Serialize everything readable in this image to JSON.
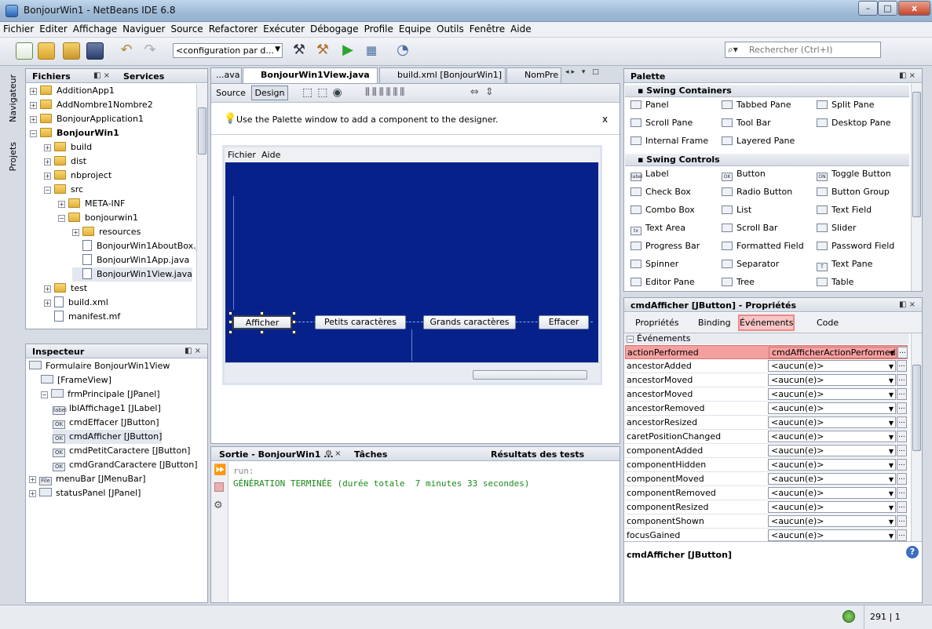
{
  "window": {
    "title": "BonjourWin1 - NetBeans IDE 6.8",
    "min": "–",
    "max": "□",
    "close": "x"
  },
  "menu": [
    "Fichier",
    "Editer",
    "Affichage",
    "Naviguer",
    "Source",
    "Refactorer",
    "Exécuter",
    "Débogage",
    "Profile",
    "Equipe",
    "Outils",
    "Fenêtre",
    "Aide"
  ],
  "toolbar": {
    "config": "<configuration par d...",
    "search_placeholder": "Rechercher (Ctrl+I)"
  },
  "left_strip": {
    "navigator": "Navigateur",
    "projects": "Projets"
  },
  "files_panel": {
    "tab1": "Fichiers",
    "tab2": "Services",
    "items": [
      {
        "label": "AdditionApp1"
      },
      {
        "label": "AddNombre1Nombre2"
      },
      {
        "label": "BonjourApplication1"
      },
      {
        "label": "BonjourWin1"
      },
      {
        "label": "build"
      },
      {
        "label": "dist"
      },
      {
        "label": "nbproject"
      },
      {
        "label": "src"
      },
      {
        "label": "META-INF"
      },
      {
        "label": "bonjourwin1"
      },
      {
        "label": "resources"
      },
      {
        "label": "BonjourWin1AboutBox.j"
      },
      {
        "label": "BonjourWin1App.java"
      },
      {
        "label": "BonjourWin1View.java"
      },
      {
        "label": "test"
      },
      {
        "label": "build.xml"
      },
      {
        "label": "manifest.mf"
      }
    ]
  },
  "inspector": {
    "title": "Inspecteur",
    "items": [
      {
        "label": "Formulaire BonjourWin1View"
      },
      {
        "label": "[FrameView]"
      },
      {
        "label": "frmPrincipale [JPanel]"
      },
      {
        "label": "lblAffichage1 [JLabel]",
        "icon": "label"
      },
      {
        "label": "cmdEffacer [JButton]",
        "icon": "OK"
      },
      {
        "label": "cmdAfficher [JButton]",
        "icon": "OK"
      },
      {
        "label": "cmdPetitCaractere [JButton]",
        "icon": "OK"
      },
      {
        "label": "cmdGrandCaractere [JButton]",
        "icon": "OK"
      },
      {
        "label": "menuBar [JMenuBar]",
        "icon": "File"
      },
      {
        "label": "statusPanel [JPanel]"
      }
    ]
  },
  "editor": {
    "tabs": [
      "...ava",
      "BonjourWin1View.java",
      "build.xml [BonjourWin1]",
      "NomPre"
    ],
    "source_label": "Source",
    "design_label": "Design",
    "hint": "Use the Palette window to add a component to the designer.",
    "hint_close": "x",
    "form_menu": [
      "Fichier",
      "Aide"
    ],
    "buttons": [
      "Afficher",
      "Petits caractères",
      "Grands caractères",
      "Effacer"
    ]
  },
  "output": {
    "tab1": "Sortie - BonjourWin1 ...",
    "tab2": "Tâches",
    "tab3": "Résultats des tests",
    "line1": "run:",
    "line2": "GÉNÉRATION TERMINÉE (durée totale  7 minutes 33 secondes)"
  },
  "palette": {
    "title": "Palette",
    "categories": [
      {
        "name": "Swing Containers",
        "items": [
          {
            "label": "Panel"
          },
          {
            "label": "Tabbed Pane"
          },
          {
            "label": "Split Pane"
          },
          {
            "label": "Scroll Pane"
          },
          {
            "label": "Tool Bar"
          },
          {
            "label": "Desktop Pane"
          },
          {
            "label": "Internal Frame"
          },
          {
            "label": "Layered Pane"
          }
        ]
      },
      {
        "name": "Swing Controls",
        "items": [
          {
            "label": "Label",
            "icon": "label"
          },
          {
            "label": "Button",
            "icon": "OK"
          },
          {
            "label": "Toggle Button",
            "icon": "ON"
          },
          {
            "label": "Check Box"
          },
          {
            "label": "Radio Button"
          },
          {
            "label": "Button Group"
          },
          {
            "label": "Combo Box"
          },
          {
            "label": "List"
          },
          {
            "label": "Text Field"
          },
          {
            "label": "Text Area",
            "icon": "tx"
          },
          {
            "label": "Scroll Bar"
          },
          {
            "label": "Slider"
          },
          {
            "label": "Progress Bar"
          },
          {
            "label": "Formatted Field"
          },
          {
            "label": "Password Field"
          },
          {
            "label": "Spinner"
          },
          {
            "label": "Separator"
          },
          {
            "label": "Text Pane",
            "icon": "T"
          },
          {
            "label": "Editor Pane"
          },
          {
            "label": "Tree"
          },
          {
            "label": "Table"
          }
        ]
      }
    ]
  },
  "properties": {
    "title": "cmdAfficher [JButton] - Propriétés",
    "tabs": [
      "Propriétés",
      "Binding",
      "Événements",
      "Code"
    ],
    "section": "Événements",
    "rows": [
      {
        "name": "actionPerformed",
        "value": "cmdAfficherActionPerformed"
      },
      {
        "name": "ancestorAdded",
        "value": "<aucun(e)>"
      },
      {
        "name": "ancestorMoved",
        "value": "<aucun(e)>"
      },
      {
        "name": "ancestorMoved",
        "value": "<aucun(e)>"
      },
      {
        "name": "ancestorRemoved",
        "value": "<aucun(e)>"
      },
      {
        "name": "ancestorResized",
        "value": "<aucun(e)>"
      },
      {
        "name": "caretPositionChanged",
        "value": "<aucun(e)>"
      },
      {
        "name": "componentAdded",
        "value": "<aucun(e)>"
      },
      {
        "name": "componentHidden",
        "value": "<aucun(e)>"
      },
      {
        "name": "componentMoved",
        "value": "<aucun(e)>"
      },
      {
        "name": "componentRemoved",
        "value": "<aucun(e)>"
      },
      {
        "name": "componentResized",
        "value": "<aucun(e)>"
      },
      {
        "name": "componentShown",
        "value": "<aucun(e)>"
      },
      {
        "name": "focusGained",
        "value": "<aucun(e)>"
      }
    ],
    "footer": "cmdAfficher [JButton]",
    "help": "?"
  },
  "status": {
    "position": "291 | 1"
  },
  "colors": {
    "canvas": "#06228a",
    "highlight": "#f4a0a0",
    "output_green": "#1a8a1a"
  }
}
